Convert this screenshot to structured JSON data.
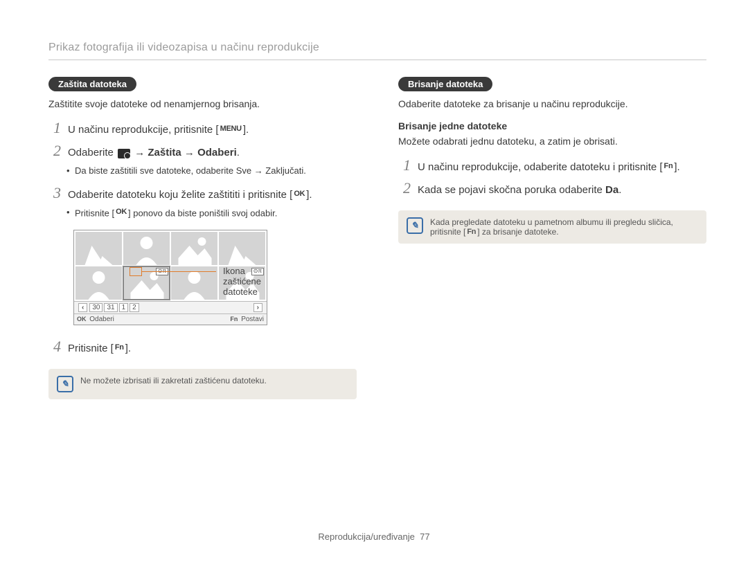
{
  "page_title": "Prikaz fotografija ili videozapisa u načinu reprodukcije",
  "left": {
    "pill": "Zaštita datoteka",
    "intro": "Zaštitite svoje datoteke od nenamjernog brisanja.",
    "step1_a": "U načinu reprodukcije, pritisnite [",
    "step1_btn": "MENU",
    "step1_b": "].",
    "step2_a": "Odaberite ",
    "step2_b": " → Zaštita → Odaberi",
    "step2_c": ".",
    "bullet2_a": "Da biste zaštitili sve datoteke, odaberite ",
    "bullet2_b": "Sve → Zaključati",
    "bullet2_c": ".",
    "step3_a": "Odaberite datoteku koju želite zaštititi i pritisnite [",
    "step3_btn": "OK",
    "step3_b": "].",
    "bullet3_a": "Pritisnite [",
    "bullet3_btn": "OK",
    "bullet3_b": "] ponovo da biste poništili svoj odabir.",
    "callout": "Ikona zaštićene datoteke",
    "dates": [
      "30",
      "31",
      "1",
      "2"
    ],
    "cmd_ok": "OK",
    "cmd_odaberi": "Odaberi",
    "cmd_fn": "Fn",
    "cmd_postavi": "Postavi",
    "step4_a": "Pritisnite [",
    "step4_btn": "Fn",
    "step4_b": "].",
    "note": "Ne možete izbrisati ili zakretati zaštićenu datoteku."
  },
  "right": {
    "pill": "Brisanje datoteka",
    "intro": "Odaberite datoteke za brisanje u načinu reprodukcije.",
    "subhead": "Brisanje jedne datoteke",
    "subintro": "Možete odabrati jednu datoteku, a zatim je obrisati.",
    "step1_a": "U načinu reprodukcije, odaberite datoteku i pritisnite [",
    "step1_btn": "Fn",
    "step1_b": "].",
    "step2_a": "Kada se pojavi skočna poruka odaberite ",
    "step2_b": "Da",
    "step2_c": ".",
    "note_a": "Kada pregledate datoteku u pametnom albumu ili pregledu sličica, pritisnite [",
    "note_btn": "Fn",
    "note_b": "] za brisanje datoteke."
  },
  "footer_a": "Reprodukcija/uređivanje",
  "footer_b": "77"
}
